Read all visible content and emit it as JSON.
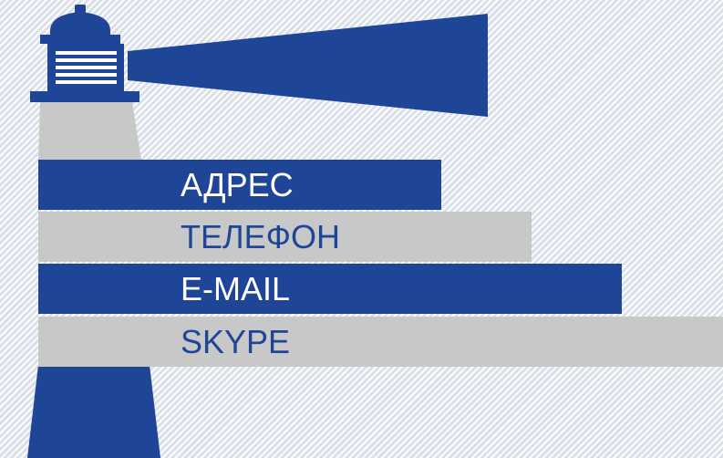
{
  "colors": {
    "brand_blue": "#1f4597",
    "light_gray": "#c8c8c8",
    "background": "#eef1f5",
    "white": "#ffffff"
  },
  "contact_items": [
    {
      "label": "АДРЕС",
      "style": "blue"
    },
    {
      "label": "ТЕЛЕФОН",
      "style": "gray"
    },
    {
      "label": "E-MAIL",
      "style": "blue"
    },
    {
      "label": "SKYPE",
      "style": "gray"
    }
  ]
}
